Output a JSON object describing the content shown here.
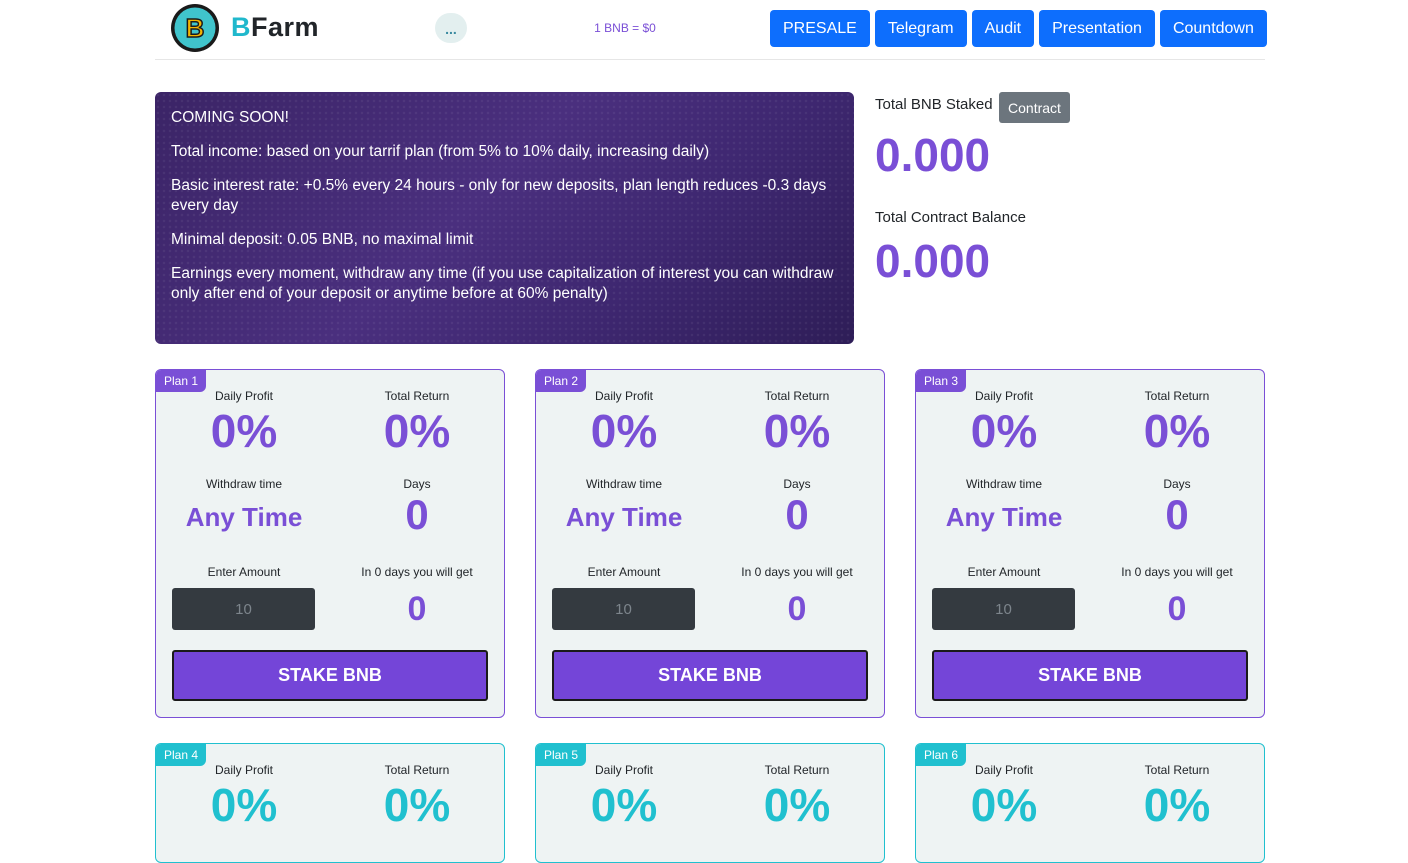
{
  "header": {
    "brand_first": "B",
    "brand_rest": "Farm",
    "logo_letter": "B",
    "wallet_label": "...",
    "price": "1 BNB = $0",
    "nav": [
      "PRESALE",
      "Telegram",
      "Audit",
      "Presentation",
      "Countdown"
    ],
    "accent": "#0d6efd"
  },
  "info": {
    "lines": [
      "COMING SOON!",
      "Total income: based on your tarrif plan (from 5% to 10% daily, increasing daily)",
      "Basic interest rate: +0.5% every 24 hours - only for new deposits, plan length reduces -0.3 days every day",
      "Minimal deposit: 0.05 BNB, no maximal limit",
      "Earnings every moment, withdraw any time (if you use capitalization of interest you can withdraw only after end of your deposit or anytime before at 60% penalty)"
    ]
  },
  "stats": {
    "staked_label": "Total BNB Staked",
    "contract_button": "Contract",
    "staked_value": "0.000",
    "balance_label": "Total Contract Balance",
    "balance_value": "0.000"
  },
  "labels": {
    "daily_profit": "Daily Profit",
    "total_return": "Total Return",
    "withdraw_time": "Withdraw time",
    "days": "Days",
    "enter_amount": "Enter Amount",
    "you_will_get": "In 0 days you will get",
    "stake": "STAKE BNB"
  },
  "plans": [
    {
      "name": "Plan 1",
      "daily": "0%",
      "total": "0%",
      "withdraw": "Any Time",
      "days": "0",
      "placeholder": "10",
      "get": "0"
    },
    {
      "name": "Plan 2",
      "daily": "0%",
      "total": "0%",
      "withdraw": "Any Time",
      "days": "0",
      "placeholder": "10",
      "get": "0"
    },
    {
      "name": "Plan 3",
      "daily": "0%",
      "total": "0%",
      "withdraw": "Any Time",
      "days": "0",
      "placeholder": "10",
      "get": "0"
    },
    {
      "name": "Plan 4",
      "daily": "0%",
      "total": "0%"
    },
    {
      "name": "Plan 5",
      "daily": "0%",
      "total": "0%"
    },
    {
      "name": "Plan 6",
      "daily": "0%",
      "total": "0%"
    }
  ],
  "colors": {
    "purple": "#7a4fd6",
    "teal": "#20c0cf"
  }
}
